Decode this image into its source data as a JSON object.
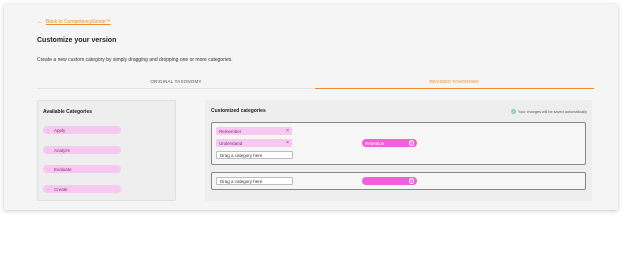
{
  "nav": {
    "back_label": "Back to CompetencyGenie™"
  },
  "page": {
    "title": "Customize your version",
    "subtitle": "Create a new custom category by simply dragging and dropping one or more categories."
  },
  "tabs": [
    {
      "label": "ORIGINAL TAXONOMY",
      "active": false
    },
    {
      "label": "REVISED TAXONOMY",
      "active": true
    }
  ],
  "available": {
    "heading": "Available Categories",
    "items": [
      "Apply",
      "Analyze",
      "Evaluate",
      "Create"
    ]
  },
  "customized": {
    "heading": "Customized categories",
    "saved_notice": "Your changes will be saved automatically",
    "groups": [
      {
        "chips": [
          "Remember",
          "Understand"
        ],
        "drop_placeholder": "Drag a category here",
        "name": "Retention"
      },
      {
        "chips": [],
        "drop_placeholder": "Drag a category here",
        "name": ""
      }
    ]
  },
  "colors": {
    "accent": "#f08a24",
    "chip": "#f7c8f0",
    "pill": "#f060d8",
    "saved_check": "#8fd19e"
  },
  "icons": {
    "back": "arrow-left-icon",
    "remove": "close-icon",
    "edit": "pencil-icon",
    "saved": "check-circle-icon",
    "drag": "drag-handle-icon"
  }
}
